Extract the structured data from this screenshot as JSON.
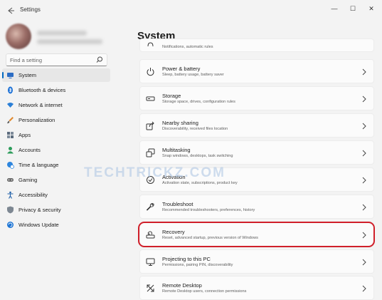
{
  "window": {
    "title": "Settings",
    "controls": [
      "—",
      "☐",
      "✕"
    ]
  },
  "search": {
    "placeholder": "Find a setting"
  },
  "sidebar": {
    "items": [
      {
        "label": "System",
        "icon": "monitor-icon",
        "active": true
      },
      {
        "label": "Bluetooth & devices",
        "icon": "bluetooth-icon"
      },
      {
        "label": "Network & internet",
        "icon": "wifi-icon"
      },
      {
        "label": "Personalization",
        "icon": "brush-icon"
      },
      {
        "label": "Apps",
        "icon": "apps-icon"
      },
      {
        "label": "Accounts",
        "icon": "person-icon"
      },
      {
        "label": "Time & language",
        "icon": "globe-clock-icon"
      },
      {
        "label": "Gaming",
        "icon": "gamepad-icon"
      },
      {
        "label": "Accessibility",
        "icon": "accessibility-icon"
      },
      {
        "label": "Privacy & security",
        "icon": "shield-icon"
      },
      {
        "label": "Windows Update",
        "icon": "update-icon"
      }
    ]
  },
  "main": {
    "title": "System",
    "cards": [
      {
        "title": "",
        "subtitle": "Notifications, automatic rules",
        "icon": "notifications-icon"
      },
      {
        "title": "Power & battery",
        "subtitle": "Sleep, battery usage, battery saver",
        "icon": "power-icon"
      },
      {
        "title": "Storage",
        "subtitle": "Storage space, drives, configuration rules",
        "icon": "storage-icon"
      },
      {
        "title": "Nearby sharing",
        "subtitle": "Discoverability, received files location",
        "icon": "share-icon"
      },
      {
        "title": "Multitasking",
        "subtitle": "Snap windows, desktops, task switching",
        "icon": "multitasking-icon"
      },
      {
        "title": "Activation",
        "subtitle": "Activation state, subscriptions, product key",
        "icon": "activation-icon"
      },
      {
        "title": "Troubleshoot",
        "subtitle": "Recommended troubleshooters, preferences, history",
        "icon": "wrench-icon"
      },
      {
        "title": "Recovery",
        "subtitle": "Reset, advanced startup, previous version of Windows",
        "icon": "recovery-icon"
      },
      {
        "title": "Projecting to this PC",
        "subtitle": "Permissions, pairing PIN, discoverability",
        "icon": "projecting-icon"
      },
      {
        "title": "Remote Desktop",
        "subtitle": "Remote Desktop users, connection permissions",
        "icon": "remote-desktop-icon"
      }
    ]
  },
  "watermark": "TECHTRICKZ.COM",
  "colors": {
    "accent": "#0067c0",
    "highlight": "#d01f2a",
    "background": "#f3f3f3",
    "card": "#fbfbfb"
  }
}
